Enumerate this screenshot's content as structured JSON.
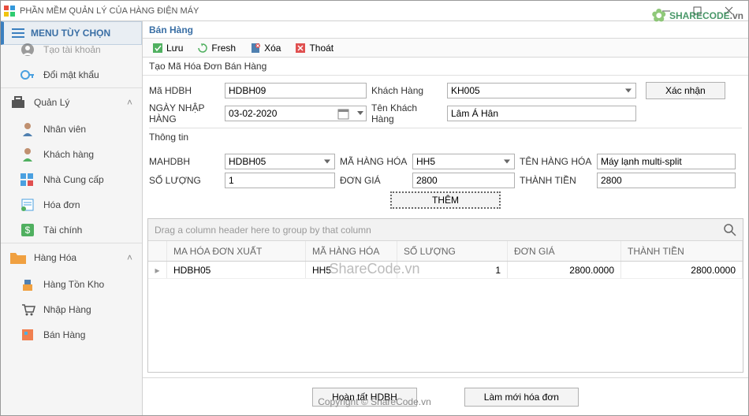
{
  "window": {
    "title": "PHẦN MỀM QUẢN LÝ CỦA HÀNG ĐIỆN MÁY",
    "brand": {
      "a": "SHARE",
      "b": "CODE",
      "c": ".vn"
    }
  },
  "sidebar": {
    "menu_header": "MENU TÙY CHỌN",
    "top_items": [
      {
        "label": "Tạo tài khoản"
      },
      {
        "label": "Đổi mật khẩu"
      }
    ],
    "quanly": {
      "title": "Quản Lý",
      "items": [
        {
          "label": "Nhân viên"
        },
        {
          "label": "Khách hàng"
        },
        {
          "label": "Nhà Cung cấp"
        },
        {
          "label": "Hóa đơn"
        },
        {
          "label": "Tài chính"
        }
      ]
    },
    "hanghoa": {
      "title": "Hàng Hóa",
      "items": [
        {
          "label": "Hàng Tồn Kho"
        },
        {
          "label": "Nhập Hàng"
        },
        {
          "label": "Bán Hàng"
        }
      ]
    }
  },
  "content": {
    "title": "Bán Hàng",
    "toolbar": {
      "save": "Lưu",
      "fresh": "Fresh",
      "delete": "Xóa",
      "exit": "Thoát"
    },
    "section1": "Tạo Mã Hóa Đơn Bán Hàng",
    "labels": {
      "ma_hdbh": "Mã HDBH",
      "khach_hang": "Khách Hàng",
      "xac_nhan": "Xác nhận",
      "ngay_nhap": "NGÀY NHẬP HÀNG",
      "ten_kh": "Tên Khách Hàng",
      "thongtin": "Thông tin",
      "mahdbh": "MAHDBH",
      "ma_hh": "MÃ HÀNG HÓA",
      "ten_hh": "TÊN HÀNG HÓA",
      "so_luong": "SỐ LƯỢNG",
      "don_gia": "ĐƠN GIÁ",
      "thanh_tien": "THÀNH TIỀN",
      "them": "THÊM"
    },
    "values": {
      "ma_hdbh": "HDBH09",
      "khach_hang": "KH005",
      "ngay_nhap": "03-02-2020",
      "ten_kh": "Lâm Á Hân",
      "mahdbh": "HDBH05",
      "ma_hh": "HH5",
      "ten_hh": "Máy lạnh multi-split",
      "so_luong": "1",
      "don_gia": "2800",
      "thanh_tien": "2800"
    },
    "grid": {
      "group_hint": "Drag a column header here to group by that column",
      "cols": [
        "MA HÓA ĐƠN XUẤT",
        "MÃ HÀNG HÓA",
        "SỐ LƯỢNG",
        "ĐƠN GIÁ",
        "THÀNH TIỀN"
      ],
      "rows": [
        {
          "c1": "HDBH05",
          "c2": "HH5",
          "c3": "1",
          "c4": "2800.0000",
          "c5": "2800.0000"
        }
      ]
    },
    "footer": {
      "a": "Hoàn tất HDBH",
      "b": "Làm mới hóa đơn"
    }
  },
  "watermark": {
    "center": "ShareCode.vn",
    "copy": "Copyright © ShareCode.vn"
  }
}
